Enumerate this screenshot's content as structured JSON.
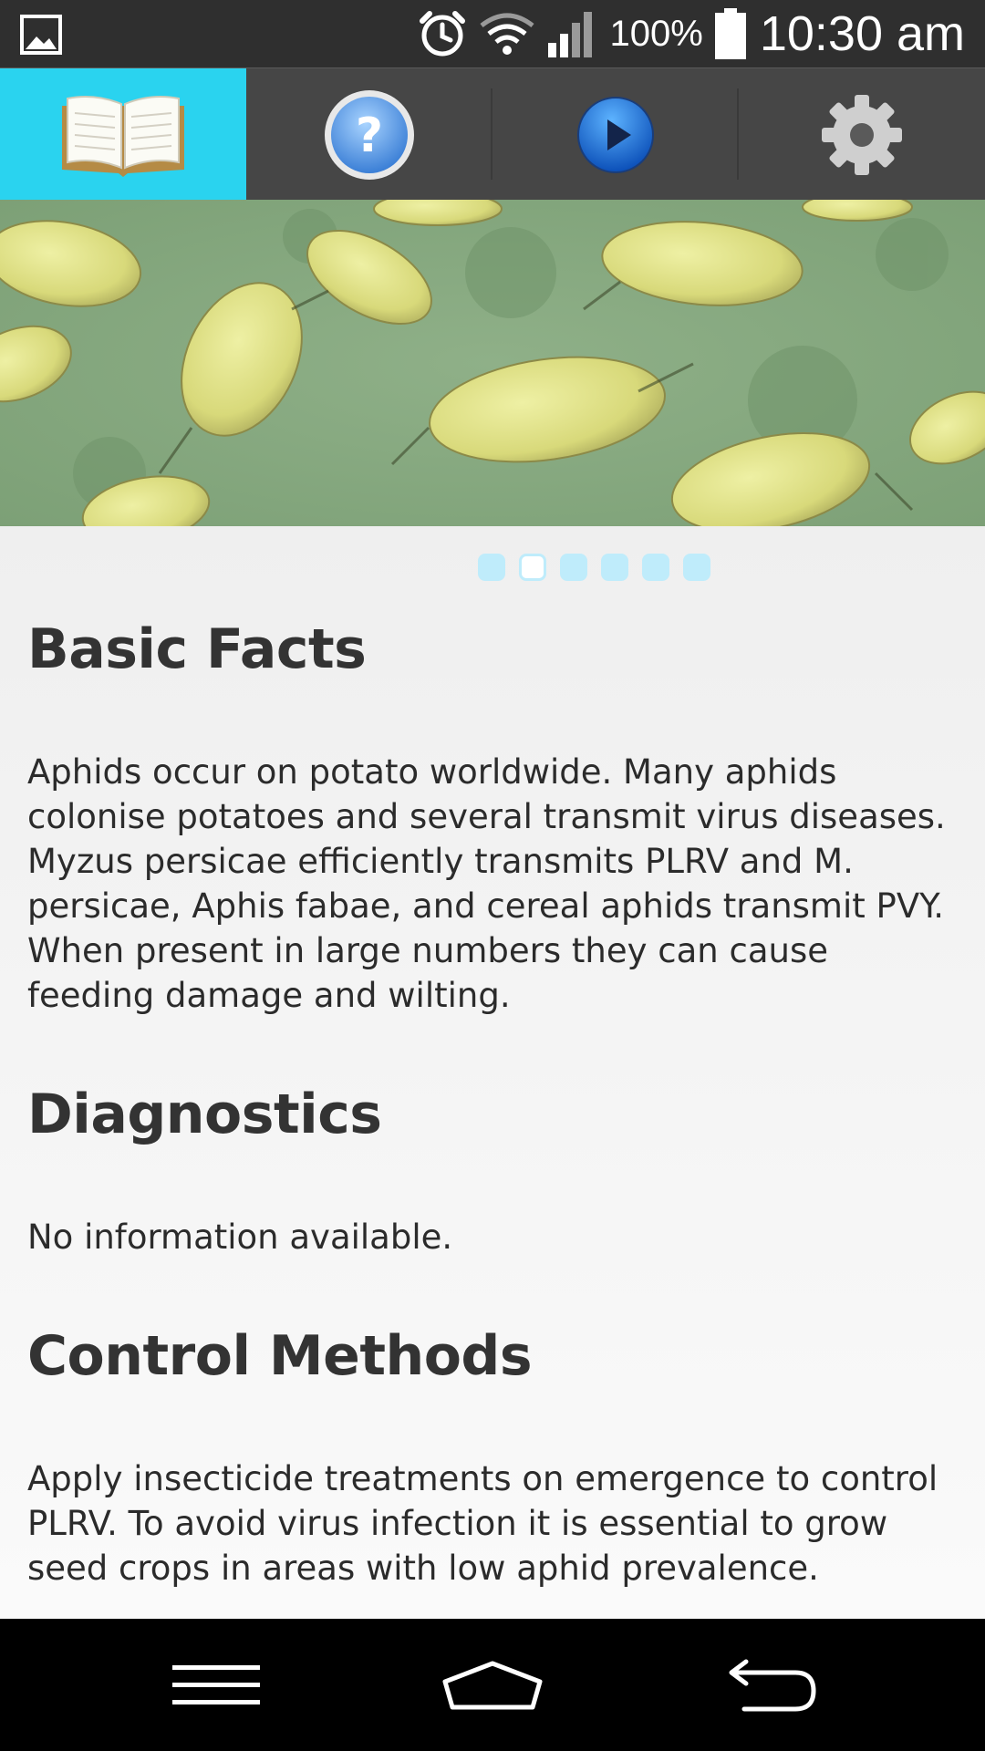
{
  "status_bar": {
    "battery_percent": "100%",
    "time": "10:30 am",
    "icons": [
      "image-notification-icon",
      "alarm-icon",
      "wifi-icon",
      "signal-icon",
      "battery-icon"
    ]
  },
  "toolbar": {
    "tabs": [
      {
        "icon": "book-icon",
        "active": true
      },
      {
        "icon": "help-icon",
        "active": false
      },
      {
        "icon": "play-icon",
        "active": false
      },
      {
        "icon": "gear-icon",
        "active": false
      }
    ],
    "accent": "#2ad3ef"
  },
  "carousel": {
    "page_count": 6,
    "current_index": 1
  },
  "sections": [
    {
      "heading": "Basic Facts",
      "body": "Aphids occur on potato worldwide.  Many aphids colonise potatoes and several transmit virus diseases.  Myzus persicae efficiently transmits PLRV and M. persicae, Aphis fabae, and cereal aphids transmit PVY.  When present in large numbers they can cause feeding damage and wilting."
    },
    {
      "heading": "Diagnostics",
      "body": "No information available."
    },
    {
      "heading": "Control Methods",
      "body": "Apply insecticide treatments on emergence to control PLRV.  To avoid virus infection it is essential to grow seed crops in areas with low aphid prevalence."
    }
  ],
  "navbar": {
    "icons": [
      "menu-icon",
      "home-icon",
      "back-icon"
    ]
  }
}
